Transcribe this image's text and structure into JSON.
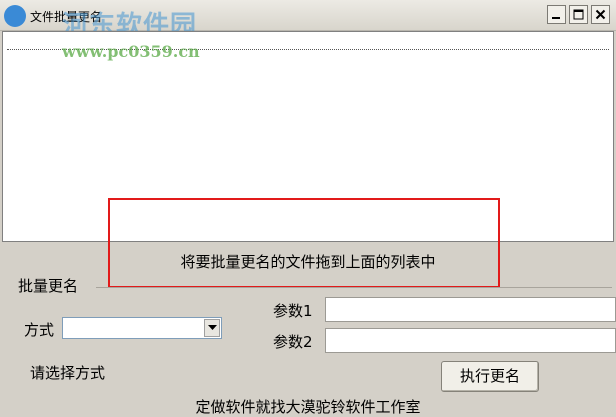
{
  "window": {
    "title": "文件批量更名",
    "minimize_icon": "minimize-icon",
    "maximize_icon": "maximize-icon",
    "close_icon": "close-icon"
  },
  "watermark": {
    "brand": "河东软件园",
    "url": "www.pc0359.cn"
  },
  "file_list": {
    "items": []
  },
  "drop_hint": "将要批量更名的文件拖到上面的列表中",
  "rename_group": {
    "title": "批量更名",
    "mode_label": "方式",
    "mode_value": "",
    "param1_label": "参数1",
    "param1_value": "",
    "param2_label": "参数2",
    "param2_value": "",
    "status": "请选择方式",
    "execute_button": "执行更名"
  },
  "footer": "定做软件就找大漠驼铃软件工作室",
  "colors": {
    "highlight_box": "#e21a1a",
    "window_bg": "#d4d0c8"
  }
}
